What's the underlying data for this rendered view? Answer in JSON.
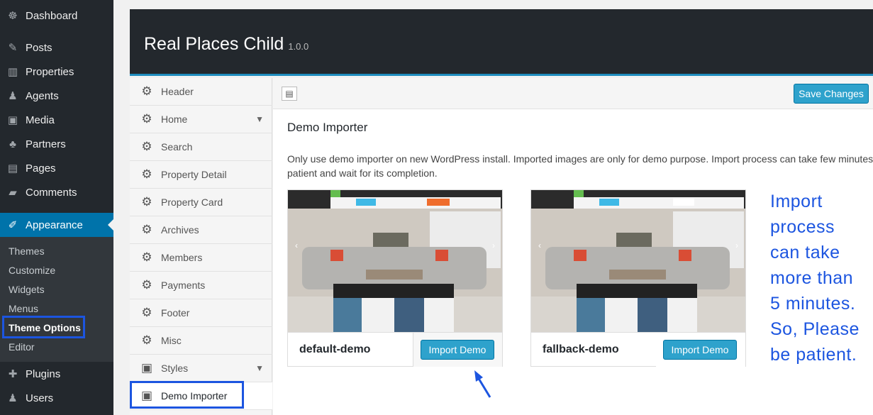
{
  "wp_menu": {
    "items": [
      {
        "label": "Dashboard",
        "icon": "dashboard-icon",
        "glyph": "☸"
      },
      {
        "label": "Posts",
        "icon": "pin-icon",
        "glyph": "✎"
      },
      {
        "label": "Properties",
        "icon": "building-icon",
        "glyph": "▥"
      },
      {
        "label": "Agents",
        "icon": "user-icon",
        "glyph": "♟"
      },
      {
        "label": "Media",
        "icon": "media-icon",
        "glyph": "▣"
      },
      {
        "label": "Partners",
        "icon": "group-icon",
        "glyph": "♣"
      },
      {
        "label": "Pages",
        "icon": "page-icon",
        "glyph": "▤"
      },
      {
        "label": "Comments",
        "icon": "comment-icon",
        "glyph": "▰"
      },
      {
        "label": "Appearance",
        "icon": "brush-icon",
        "glyph": "✐"
      },
      {
        "label": "Plugins",
        "icon": "plug-icon",
        "glyph": "✚"
      },
      {
        "label": "Users",
        "icon": "users-icon",
        "glyph": "♟"
      }
    ],
    "submenu": [
      "Themes",
      "Customize",
      "Widgets",
      "Menus",
      "Theme Options",
      "Editor"
    ]
  },
  "header": {
    "title": "Real Places Child",
    "version": "1.0.0"
  },
  "options_nav": {
    "items": [
      {
        "label": "Header",
        "icon": "gear-icon"
      },
      {
        "label": "Home",
        "icon": "gear-icon"
      },
      {
        "label": "Search",
        "icon": "gear-icon"
      },
      {
        "label": "Property Detail",
        "icon": "gear-icon"
      },
      {
        "label": "Property Card",
        "icon": "gear-icon"
      },
      {
        "label": "Archives",
        "icon": "gear-icon"
      },
      {
        "label": "Members",
        "icon": "gear-icon"
      },
      {
        "label": "Payments",
        "icon": "gear-icon"
      },
      {
        "label": "Footer",
        "icon": "gear-icon"
      },
      {
        "label": "Misc",
        "icon": "gear-icon"
      },
      {
        "label": "Styles",
        "icon": "panel-icon"
      },
      {
        "label": "Demo Importer",
        "icon": "panel-icon"
      }
    ]
  },
  "toolbar": {
    "save_label": "Save Changes"
  },
  "section": {
    "title": "Demo Importer",
    "description_line1": "Only use demo importer on new WordPress install. Imported images are only for demo purpose. Import process can take few minutes to",
    "description_line2": "patient and wait for its completion."
  },
  "demos": [
    {
      "name": "default-demo",
      "button": "Import Demo"
    },
    {
      "name": "fallback-demo",
      "button": "Import Demo"
    }
  ],
  "annotation": [
    "Import",
    "process",
    "can take",
    "more than",
    "5 minutes.",
    "So, Please",
    "be patient."
  ],
  "colors": {
    "admin_bar": "#23282d",
    "accent": "#0073aa",
    "button": "#2ea2cc",
    "highlight": "#1c55e0"
  }
}
